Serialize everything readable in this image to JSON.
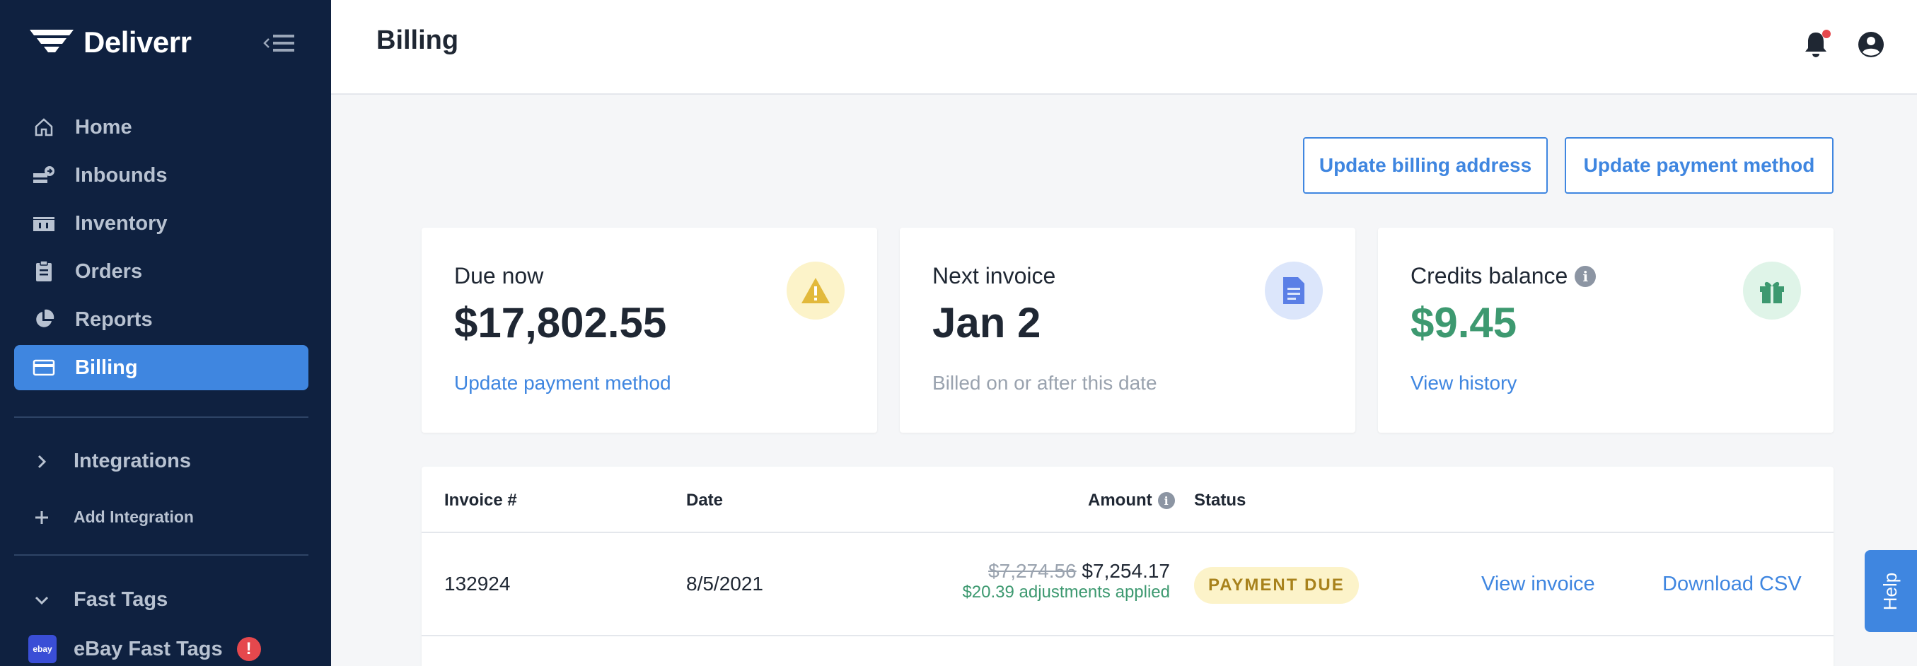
{
  "sidebar": {
    "brand": "Deliverr",
    "collapse_icon": "collapse-menu-icon",
    "nav": [
      {
        "label": "Home",
        "icon": "home-icon"
      },
      {
        "label": "Inbounds",
        "icon": "inbounds-icon"
      },
      {
        "label": "Inventory",
        "icon": "inventory-icon"
      },
      {
        "label": "Orders",
        "icon": "orders-icon"
      },
      {
        "label": "Reports",
        "icon": "reports-icon"
      },
      {
        "label": "Billing",
        "icon": "billing-icon",
        "active": true
      }
    ],
    "integrations_label": "Integrations",
    "add_integration_label": "Add Integration",
    "fast_tags_label": "Fast Tags",
    "ebay_label": "eBay Fast Tags",
    "ebay_logo_text": "ebay",
    "ebay_alert": "!"
  },
  "header": {
    "title": "Billing",
    "has_notification": true
  },
  "actions": {
    "update_billing_address": "Update billing address",
    "update_payment_method": "Update payment method"
  },
  "cards": {
    "due_now": {
      "label": "Due now",
      "value": "$17,802.55",
      "link": "Update payment method",
      "icon": "warning-icon"
    },
    "next_invoice": {
      "label": "Next invoice",
      "value": "Jan 2",
      "sub": "Billed on or after this date",
      "icon": "document-icon"
    },
    "credits": {
      "label": "Credits balance",
      "value": "$9.45",
      "link": "View history",
      "icon": "gift-icon"
    }
  },
  "table": {
    "headers": {
      "invoice": "Invoice #",
      "date": "Date",
      "amount": "Amount",
      "status": "Status"
    },
    "rows": [
      {
        "invoice": "132924",
        "date": "8/5/2021",
        "original_amount": "$7,274.56",
        "amount": "$7,254.17",
        "adjustment": "$20.39 adjustments applied",
        "status": "PAYMENT DUE",
        "view_link": "View invoice",
        "download_link": "Download CSV"
      }
    ]
  },
  "help": {
    "label": "Help"
  },
  "colors": {
    "sidebar_bg": "#0f2140",
    "accent": "#3f86e0",
    "green": "#3d9970",
    "warning_bg": "#fcf3c9",
    "danger": "#e5484d"
  }
}
